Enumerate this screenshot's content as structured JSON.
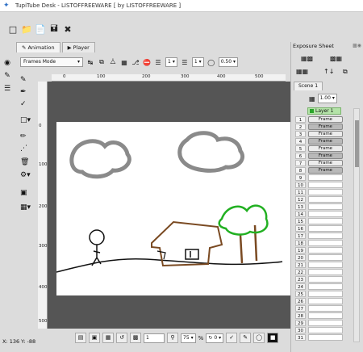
{
  "app": {
    "title": "TupiTube Desk - LISTOFFREEWARE [ by LISTOFFREEWARE ]"
  },
  "tabs": [
    {
      "label": "Animation"
    },
    {
      "label": "Player"
    }
  ],
  "canvas_toolbar": {
    "mode": "Frames Mode",
    "spin1": "1",
    "spin2": "1",
    "opacity": "0.50"
  },
  "ruler": {
    "h": [
      "0",
      "100",
      "200",
      "300",
      "400",
      "500"
    ],
    "v": [
      "0",
      "100",
      "200",
      "300",
      "400",
      "500"
    ]
  },
  "status": {
    "coords": "X: 136 Y: -88"
  },
  "bottom": {
    "frame": "1",
    "zoom": "75",
    "rotation": "0",
    "unit": "%"
  },
  "exposure": {
    "title": "Exposure Sheet",
    "scene": "Scene 1",
    "fps": "1.00",
    "layer": "Layer 1",
    "rows": [
      "1",
      "2",
      "3",
      "4",
      "5",
      "6",
      "7",
      "8",
      "9",
      "10",
      "11",
      "12",
      "13",
      "14",
      "15",
      "16",
      "17",
      "18",
      "19",
      "20",
      "21",
      "22",
      "23",
      "24",
      "25",
      "26",
      "27",
      "28",
      "29",
      "30",
      "31"
    ],
    "frame_label": "Frame"
  },
  "colors": {
    "accent": "#2aa52a",
    "workspace": "#555555"
  },
  "icons": [
    "new-icon",
    "open-icon",
    "save-icon",
    "save-as-icon",
    "close-icon"
  ]
}
